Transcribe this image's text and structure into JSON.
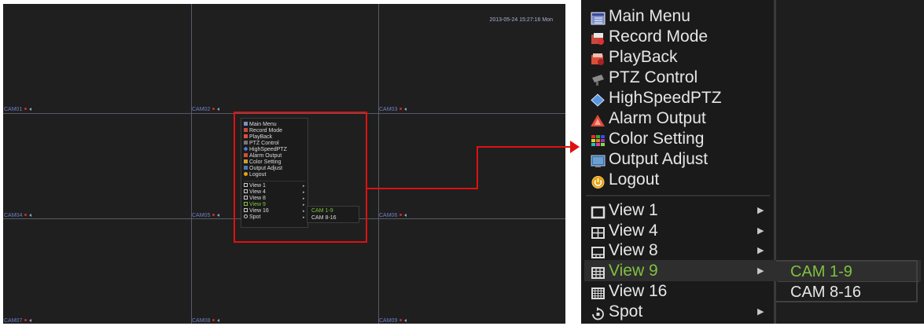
{
  "screen": {
    "timestamp": "2013-05-24 15:27:16 Mon",
    "cameras": [
      "CAM01",
      "CAM02",
      "CAM03",
      "CAM04",
      "CAM05",
      "CAM06",
      "CAM07",
      "CAM08",
      "CAM09"
    ]
  },
  "menu": {
    "items": [
      {
        "label": "Main Menu",
        "icon": "main-menu-icon"
      },
      {
        "label": "Record Mode",
        "icon": "record-icon"
      },
      {
        "label": "PlayBack",
        "icon": "playback-icon"
      },
      {
        "label": "PTZ Control",
        "icon": "ptz-icon"
      },
      {
        "label": "HighSpeedPTZ",
        "icon": "diamond-icon"
      },
      {
        "label": "Alarm Output",
        "icon": "alarm-icon"
      },
      {
        "label": "Color Setting",
        "icon": "color-icon"
      },
      {
        "label": "Output Adjust",
        "icon": "monitor-icon"
      },
      {
        "label": "Logout",
        "icon": "power-icon"
      }
    ],
    "views": [
      {
        "label": "View 1",
        "icon": "view1-icon"
      },
      {
        "label": "View 4",
        "icon": "view4-icon"
      },
      {
        "label": "View 8",
        "icon": "view8-icon"
      },
      {
        "label": "View 9",
        "icon": "view9-icon",
        "active": true
      },
      {
        "label": "View 16",
        "icon": "view16-icon"
      },
      {
        "label": "Spot",
        "icon": "spot-icon"
      }
    ],
    "submenu": [
      "CAM 1-9",
      "CAM 8-16"
    ]
  },
  "colors": {
    "highlight": "#7fc140",
    "callout": "#e01010",
    "cam_label": "#6f7fc7"
  }
}
